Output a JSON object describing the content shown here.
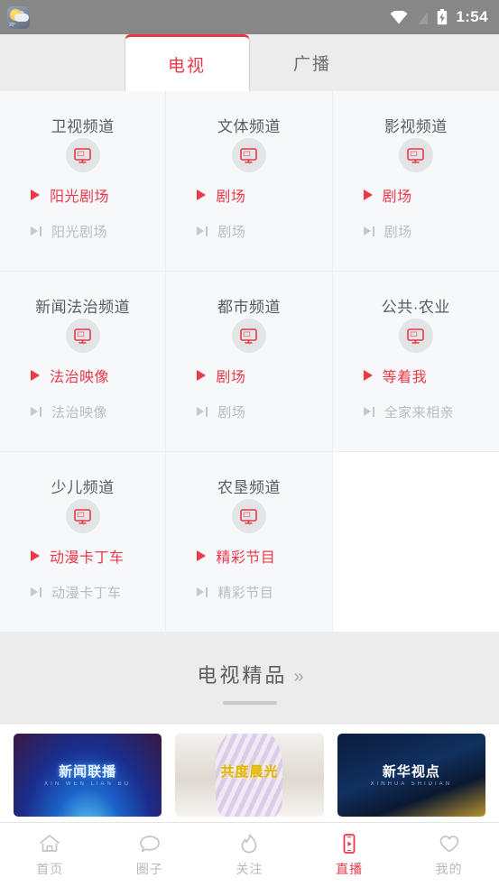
{
  "statusbar": {
    "notification_icon": "weather-icon",
    "wifi_icon": "wifi-icon",
    "signal_icon": "signal-off-icon",
    "battery_icon": "battery-charging-icon",
    "time": "1:54"
  },
  "tabs": [
    {
      "label": "电视",
      "active": true
    },
    {
      "label": "广播",
      "active": false
    }
  ],
  "colors": {
    "accent": "#e8394a",
    "muted": "#b7bcc2",
    "title": "#555c63",
    "page_bg": "#ececec",
    "card_bg": "#f7f8f9"
  },
  "channels": [
    {
      "title": "卫视频道",
      "icon": "tv-monitor-icon",
      "now": "阳光剧场",
      "next": "阳光剧场"
    },
    {
      "title": "文体频道",
      "icon": "tv-monitor-icon",
      "now": "剧场",
      "next": "剧场"
    },
    {
      "title": "影视频道",
      "icon": "tv-monitor-icon",
      "now": "剧场",
      "next": "剧场"
    },
    {
      "title": "新闻法治频道",
      "icon": "tv-monitor-icon",
      "now": "法治映像",
      "next": "法治映像"
    },
    {
      "title": "都市频道",
      "icon": "tv-monitor-icon",
      "now": "剧场",
      "next": "剧场"
    },
    {
      "title": "公共·农业",
      "icon": "tv-monitor-icon",
      "now": "等着我",
      "next": "全家来相亲"
    },
    {
      "title": "少儿频道",
      "icon": "tv-monitor-icon",
      "now": "动漫卡丁车",
      "next": "动漫卡丁车"
    },
    {
      "title": "农垦频道",
      "icon": "tv-monitor-icon",
      "now": "精彩节目",
      "next": "精彩节目"
    }
  ],
  "section": {
    "title": "电视精品",
    "chevron": "»"
  },
  "thumbnails": [
    {
      "caption": "新闻联播",
      "subcaption": "XIN WEN LIAN BO"
    },
    {
      "caption": "共度晨光",
      "subcaption": ""
    },
    {
      "caption": "新华视点",
      "subcaption": "XINHUA SHIDIAN"
    }
  ],
  "bottomnav": [
    {
      "label": "首页",
      "icon": "home-icon",
      "active": false
    },
    {
      "label": "圈子",
      "icon": "chat-icon",
      "active": false
    },
    {
      "label": "关注",
      "icon": "flame-icon",
      "active": false
    },
    {
      "label": "直播",
      "icon": "live-phone-icon",
      "active": true
    },
    {
      "label": "我的",
      "icon": "heart-icon",
      "active": false
    }
  ]
}
